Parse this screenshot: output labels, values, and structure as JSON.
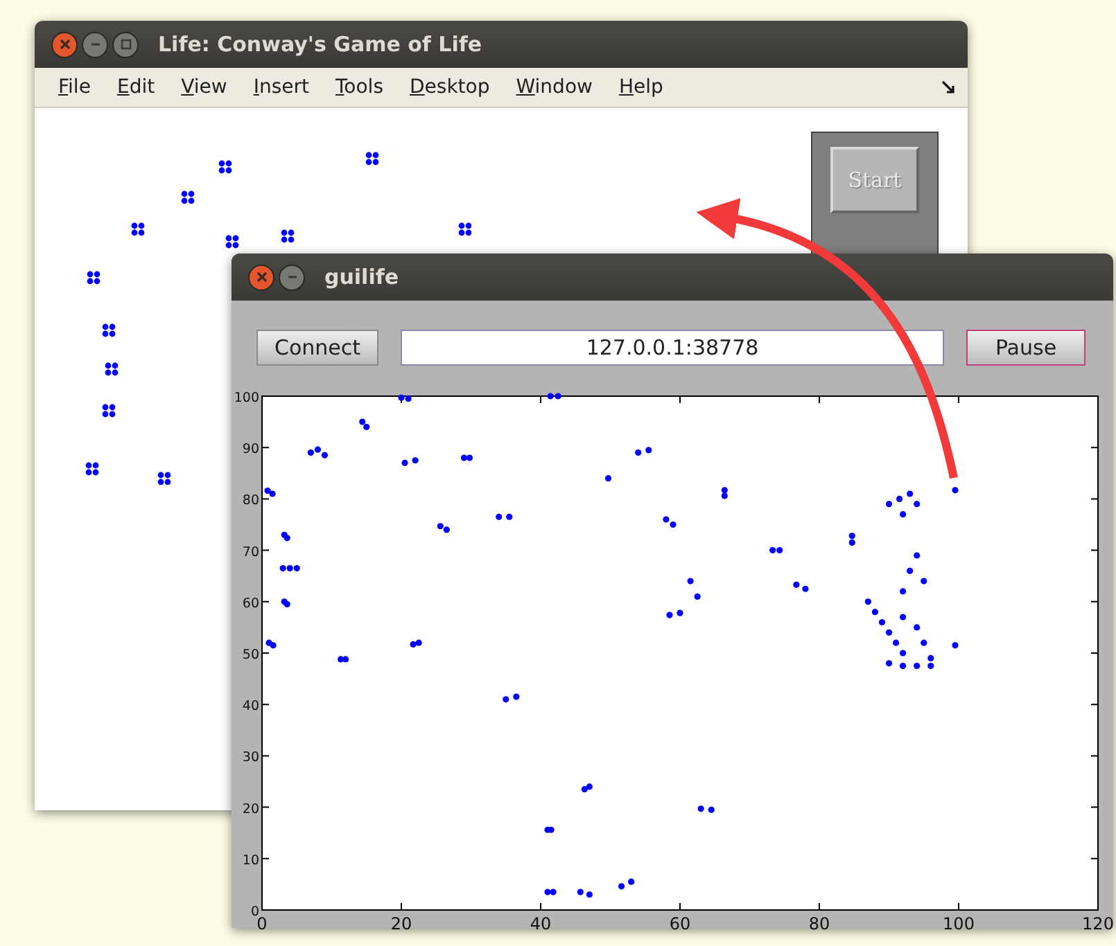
{
  "windows": [
    {
      "title": "Life: Conway's Game of Life",
      "controls": [
        {
          "kind": "close"
        },
        {
          "kind": "minimize"
        },
        {
          "kind": "maximize"
        }
      ],
      "menu": [
        "File",
        "Edit",
        "View",
        "Insert",
        "Tools",
        "Desktop",
        "Window",
        "Help"
      ],
      "panel_buttons": [
        {
          "label": "Start",
          "disabled": true
        }
      ]
    },
    {
      "title": "guilife",
      "controls": [
        {
          "kind": "close"
        },
        {
          "kind": "minimize"
        }
      ],
      "connect_button": {
        "label": "Connect",
        "focused": false
      },
      "address_field": {
        "value": "127.0.0.1:38778"
      },
      "pause_button": {
        "label": "Pause",
        "focused": true
      },
      "chart_data": {
        "type": "scatter",
        "xlim": [
          0,
          120
        ],
        "ylim": [
          0,
          100
        ],
        "xticks": [
          0,
          20,
          40,
          60,
          80,
          100,
          120
        ],
        "yticks": [
          0,
          10,
          20,
          30,
          40,
          50,
          60,
          70,
          80,
          90,
          100
        ],
        "x": [
          0.8,
          1.5,
          3.2,
          3.6,
          3,
          4,
          5,
          3.2,
          3.6,
          1,
          1.6,
          11.3,
          12,
          14.4,
          15,
          7,
          8,
          9,
          20,
          21,
          20.5,
          22,
          21.7,
          22.5,
          25.6,
          26.5,
          29,
          29.8,
          34,
          35.5,
          35,
          36.5,
          41.4,
          42.5,
          41,
          41.5,
          41,
          41.8,
          46.3,
          47,
          45.7,
          47,
          51.6,
          53,
          49.7,
          54,
          55.5,
          58,
          59,
          58.5,
          60,
          61.5,
          62.5,
          66.4,
          66.4,
          63,
          64.5,
          73.3,
          74.3,
          76.7,
          78,
          84.7,
          84.7,
          90,
          91.5,
          93,
          94,
          92,
          87,
          88,
          89,
          90,
          91,
          92,
          90,
          92,
          94,
          96,
          92,
          93,
          94,
          95,
          92,
          94,
          95,
          96,
          99.5,
          99.5
        ],
        "series": [
          {
            "color": "#0000ff",
            "values": [
              81.6,
              81,
              73,
              72.4,
              66.5,
              66.5,
              66.5,
              60,
              59.5,
              52,
              51.5,
              48.8,
              48.8,
              95,
              94,
              89,
              89.6,
              88.5,
              99.7,
              99.5,
              87,
              87.5,
              51.7,
              52,
              74.7,
              74,
              88,
              88,
              76.5,
              76.5,
              41,
              41.5,
              100,
              100,
              15.6,
              15.6,
              3.5,
              3.5,
              23.5,
              24,
              3.5,
              3,
              4.6,
              5.5,
              84,
              89,
              89.5,
              76,
              75,
              57.4,
              57.8,
              64,
              61,
              81.7,
              80.6,
              19.7,
              19.5,
              70,
              70,
              63.3,
              62.5,
              72.8,
              71.5,
              79,
              80,
              81,
              79,
              77,
              60,
              58,
              56,
              54,
              52,
              50,
              48,
              47.5,
              47.5,
              47.5,
              62,
              66,
              69,
              64,
              57,
              55,
              52,
              49,
              81.7,
              51.5
            ]
          }
        ]
      }
    }
  ]
}
